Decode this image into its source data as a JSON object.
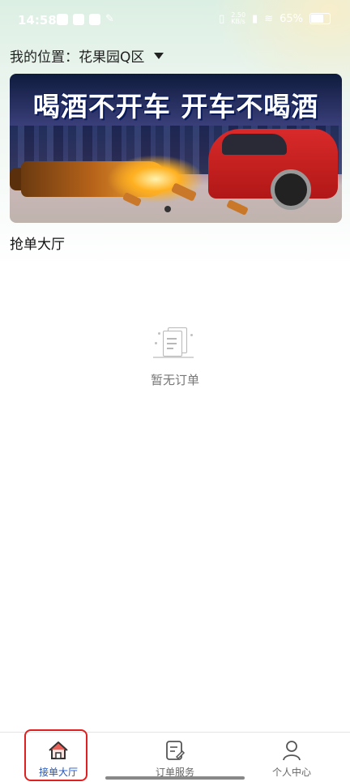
{
  "status_bar": {
    "time": "14:58",
    "net_speed": "2.50\nKB/s",
    "battery": "65%",
    "icons": [
      "play-icon",
      "leaf-icon",
      "mail-icon",
      "chat-icon",
      "vibrate-icon",
      "sim-icon",
      "wifi-icon",
      "battery-icon"
    ]
  },
  "location": {
    "label": "我的位置：",
    "value": "花果园Q区",
    "dropdown_icon": "caret-down-icon"
  },
  "banner": {
    "headline": "喝酒不开车  开车不喝酒"
  },
  "section": {
    "title": "抢单大厅"
  },
  "empty_state": {
    "icon": "empty-document-icon",
    "text": "暂无订单"
  },
  "tabbar": {
    "items": [
      {
        "label": "接单大厅",
        "icon": "home-icon",
        "active": true
      },
      {
        "label": "订单服务",
        "icon": "order-edit-icon",
        "active": false
      },
      {
        "label": "个人中心",
        "icon": "person-icon",
        "active": false
      }
    ]
  },
  "colors": {
    "active_tab": "#1f55c8",
    "home_icon": "#e8625a",
    "highlight": "#e02020"
  }
}
